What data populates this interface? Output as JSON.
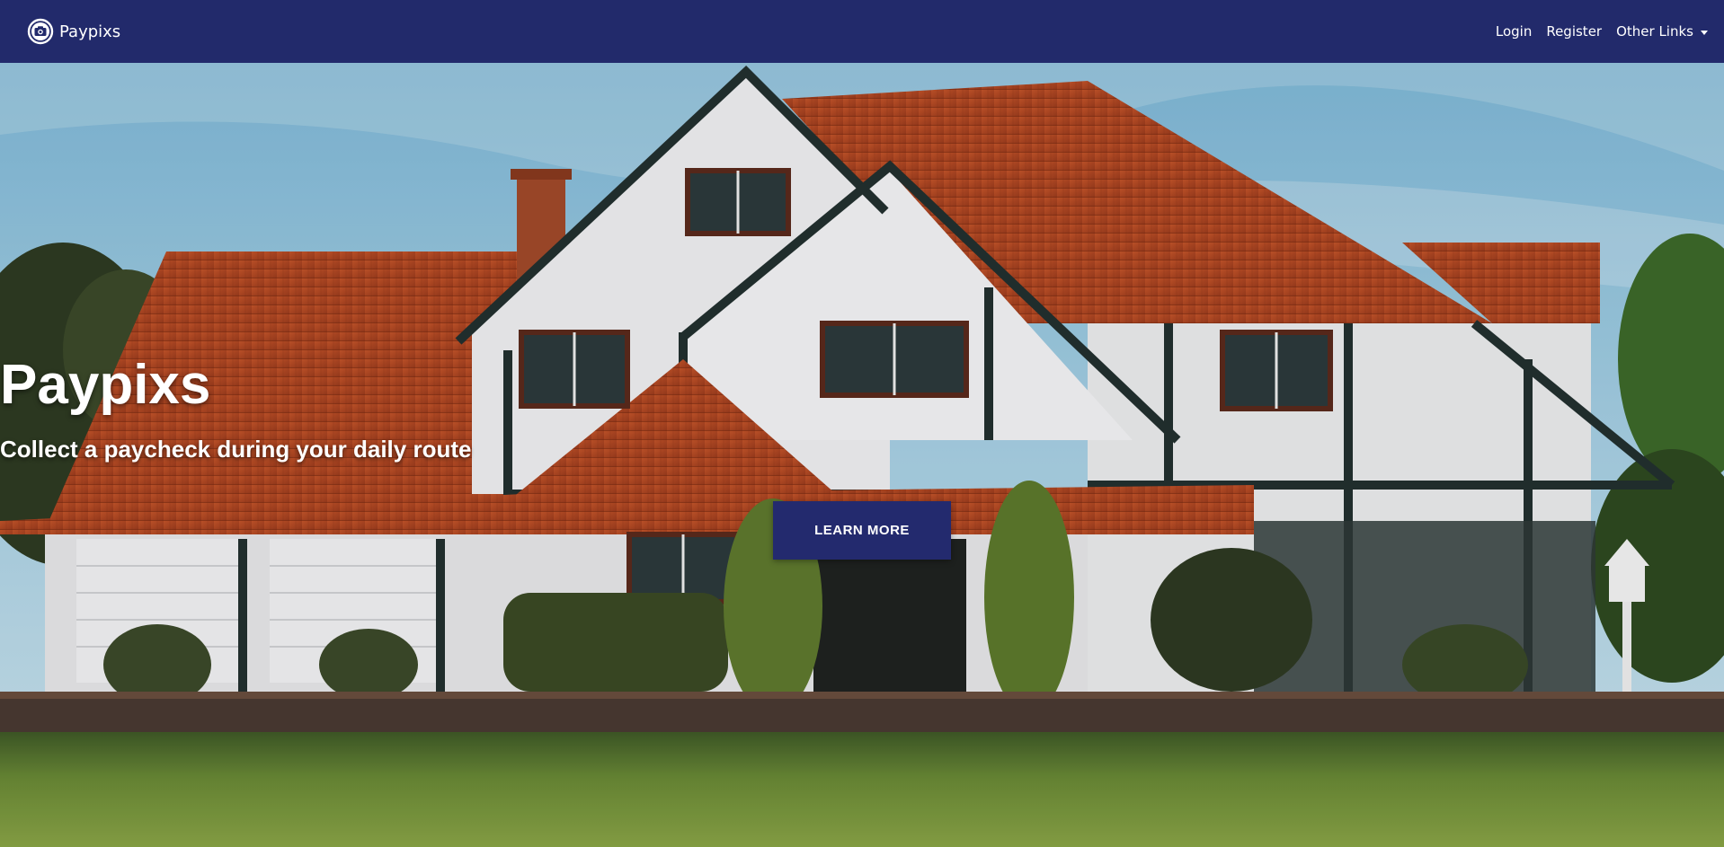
{
  "navbar": {
    "brand_icon": "camera-icon",
    "brand_label": "Paypixs",
    "links": {
      "login": "Login",
      "register": "Register",
      "other_links": "Other Links"
    },
    "background_color": "#222a6b"
  },
  "hero": {
    "title": "Paypixs",
    "subtitle": "Collect a paycheck during your daily route",
    "button_label": "LEARN MORE",
    "button_color": "#232a6e",
    "background_image": "tudor-style-house-photo"
  }
}
